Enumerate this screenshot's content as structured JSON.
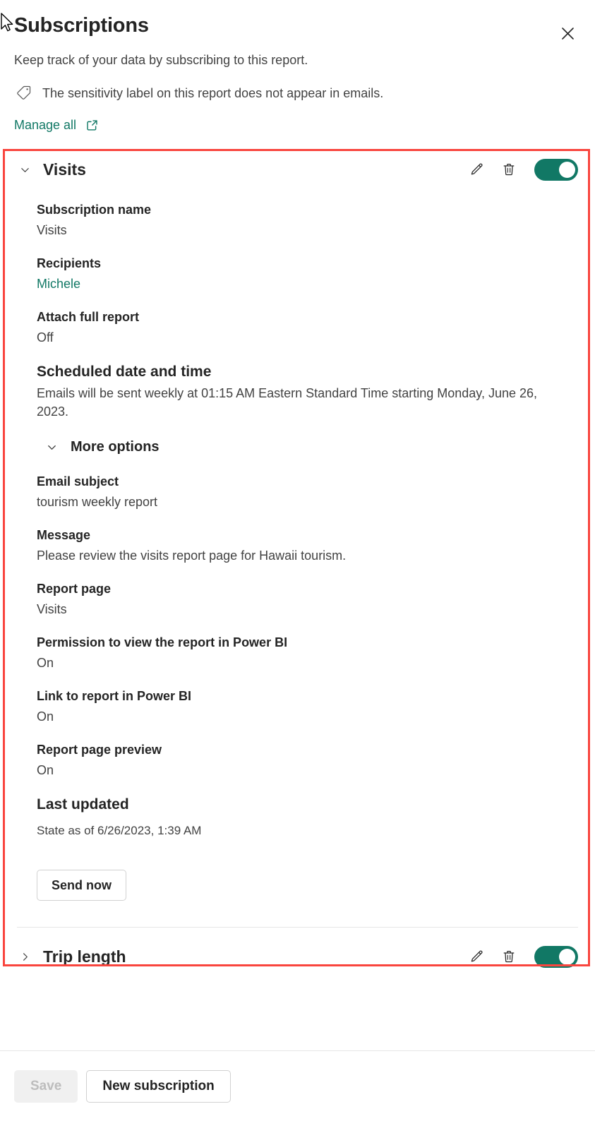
{
  "header": {
    "title": "Subscriptions",
    "close_icon": "close-icon",
    "description": "Keep track of your data by subscribing to this report.",
    "sensitivity_icon": "tag-icon",
    "sensitivity_text": "The sensitivity label on this report does not appear in emails.",
    "manage_all_label": "Manage all",
    "manage_all_icon": "external-link-icon"
  },
  "colors": {
    "accent_green": "#117865",
    "highlight_red": "#f9453e",
    "text_primary": "#242424",
    "text_secondary": "#424242",
    "disabled_text": "#bdbdbd"
  },
  "subscriptions": [
    {
      "name": "Visits",
      "expanded": true,
      "chevron_icon": "chevron-down-icon",
      "edit_icon": "pencil-icon",
      "delete_icon": "trash-icon",
      "toggle_state": "on",
      "fields": {
        "subscription_name_label": "Subscription name",
        "subscription_name_value": "Visits",
        "recipients_label": "Recipients",
        "recipients_value": "Michele",
        "attach_full_report_label": "Attach full report",
        "attach_full_report_value": "Off",
        "scheduled_label": "Scheduled date and time",
        "scheduled_value": "Emails will be sent weekly at 01:15 AM Eastern Standard Time starting Monday, June 26, 2023.",
        "more_options_label": "More options",
        "more_options_icon": "chevron-down-icon",
        "email_subject_label": "Email subject",
        "email_subject_value": "tourism weekly report",
        "message_label": "Message",
        "message_value": "Please review the visits report page for Hawaii tourism.",
        "report_page_label": "Report page",
        "report_page_value": "Visits",
        "permission_label": "Permission to view the report in Power BI",
        "permission_value": "On",
        "link_label": "Link to report in Power BI",
        "link_value": "On",
        "preview_label": "Report page preview",
        "preview_value": "On",
        "last_updated_label": "Last updated",
        "last_updated_value": "State as of 6/26/2023, 1:39 AM",
        "send_now_label": "Send now"
      }
    },
    {
      "name": "Trip length",
      "expanded": false,
      "chevron_icon": "chevron-right-icon",
      "edit_icon": "pencil-icon",
      "delete_icon": "trash-icon",
      "toggle_state": "on"
    }
  ],
  "footer": {
    "save_label": "Save",
    "save_enabled": false,
    "new_subscription_label": "New subscription"
  }
}
